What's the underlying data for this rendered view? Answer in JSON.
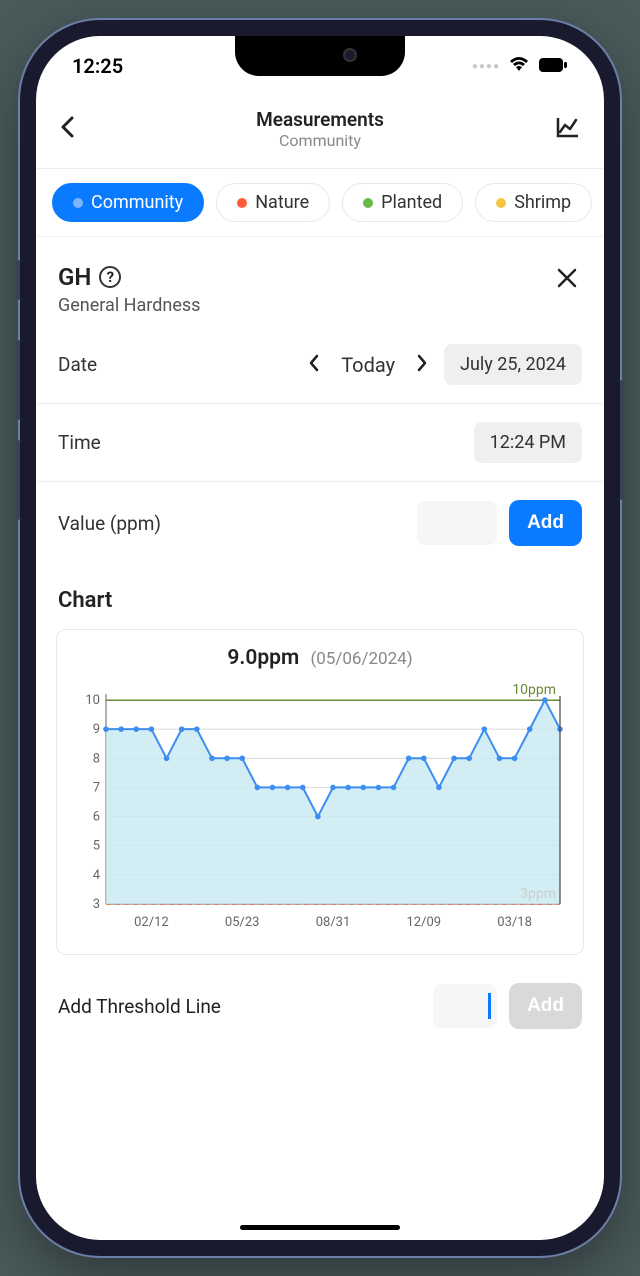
{
  "status": {
    "time": "12:25"
  },
  "header": {
    "title": "Measurements",
    "subtitle": "Community"
  },
  "chips": [
    {
      "label": "Community",
      "color": "#7db6ff",
      "active": true
    },
    {
      "label": "Nature",
      "color": "#ff5b3a",
      "active": false
    },
    {
      "label": "Planted",
      "color": "#6ab94b",
      "active": false
    },
    {
      "label": "Shrimp",
      "color": "#f5c542",
      "active": false
    }
  ],
  "param": {
    "code": "GH",
    "name": "General Hardness",
    "date_label": "Date",
    "date_stepper": "Today",
    "date_value": "July 25, 2024",
    "time_label": "Time",
    "time_value": "12:24 PM",
    "value_label": "Value (ppm)",
    "add_label": "Add"
  },
  "chart_section_title": "Chart",
  "chart_callout": {
    "value": "9.0ppm",
    "date": "(05/06/2024)"
  },
  "threshold": {
    "label": "Add Threshold Line",
    "add_label": "Add"
  },
  "chart_data": {
    "type": "line",
    "title": "GH General Hardness",
    "ylabel": "ppm",
    "ylim": [
      3,
      10
    ],
    "y_ticks": [
      3,
      4,
      5,
      6,
      7,
      8,
      9,
      10
    ],
    "x_tick_labels": [
      "02/12",
      "05/23",
      "08/31",
      "12/09",
      "03/18"
    ],
    "upper_threshold": {
      "value": 10,
      "label": "10ppm",
      "color": "#6a8a3a"
    },
    "lower_threshold": {
      "value": 3,
      "label": "3ppm",
      "color": "#d9663b"
    },
    "series": [
      {
        "name": "GH",
        "color": "#3c8ef0",
        "fill": "#c8e8f3",
        "values": [
          9,
          9,
          9,
          9,
          8,
          9,
          9,
          8,
          8,
          8,
          7,
          7,
          7,
          7,
          6,
          7,
          7,
          7,
          7,
          7,
          8,
          8,
          7,
          8,
          8,
          9,
          8,
          8,
          9,
          10,
          9
        ]
      }
    ]
  }
}
